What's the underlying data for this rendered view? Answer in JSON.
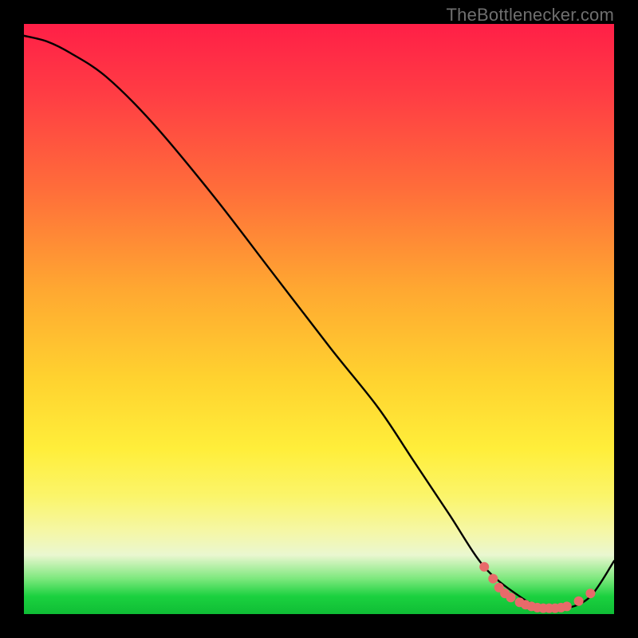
{
  "credit_text": "TheBottlenecker.com",
  "colors": {
    "frame": "#000000",
    "curve": "#000000",
    "marker": "#e86a6a",
    "credit": "#6f6f6f"
  },
  "chart_data": {
    "type": "line",
    "title": "",
    "xlabel": "",
    "ylabel": "",
    "xlim": [
      0,
      100
    ],
    "ylim": [
      0,
      100
    ],
    "series": [
      {
        "name": "curve",
        "x": [
          0,
          4,
          8,
          14,
          22,
          32,
          42,
          52,
          60,
          66,
          72,
          78,
          84,
          88,
          92,
          96,
          100
        ],
        "y": [
          98,
          97,
          95,
          91,
          83,
          71,
          58,
          45,
          35,
          26,
          17,
          8,
          3,
          1,
          1,
          3,
          9
        ]
      }
    ],
    "markers": [
      {
        "x": 78,
        "y": 8
      },
      {
        "x": 79.5,
        "y": 6
      },
      {
        "x": 80.5,
        "y": 4.5
      },
      {
        "x": 81.5,
        "y": 3.5
      },
      {
        "x": 82.5,
        "y": 2.8
      },
      {
        "x": 84,
        "y": 2.0
      },
      {
        "x": 85,
        "y": 1.6
      },
      {
        "x": 86,
        "y": 1.3
      },
      {
        "x": 87,
        "y": 1.1
      },
      {
        "x": 88,
        "y": 1.0
      },
      {
        "x": 89,
        "y": 1.0
      },
      {
        "x": 90,
        "y": 1.0
      },
      {
        "x": 91,
        "y": 1.1
      },
      {
        "x": 92,
        "y": 1.3
      },
      {
        "x": 94,
        "y": 2.2
      },
      {
        "x": 96,
        "y": 3.5
      }
    ]
  }
}
